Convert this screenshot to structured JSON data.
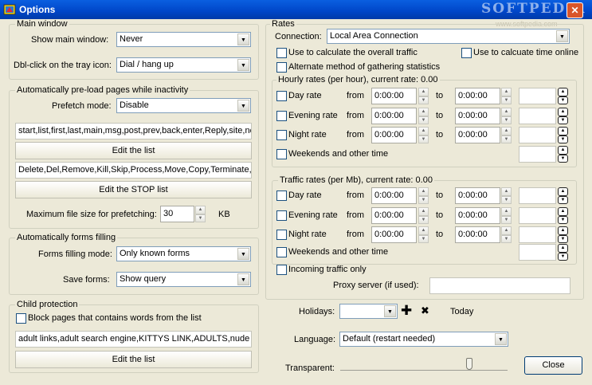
{
  "window": {
    "title": "Options",
    "watermark": "SOFTPEDIA",
    "watermark_url": "www.softpedia.com",
    "close_glyph": "✕"
  },
  "main_window": {
    "group_label": "Main window",
    "show_label": "Show main window:",
    "show_value": "Never",
    "dblclick_label": "Dbl-click on the tray icon:",
    "dblclick_value": "Dial / hang up"
  },
  "preload": {
    "group_label": "Automatically pre-load pages while inactivity",
    "prefetch_label": "Prefetch mode:",
    "prefetch_value": "Disable",
    "list_value": "start,list,first,last,main,msg,post,prev,back,enter,Reply,site,ne",
    "edit_list_button": "Edit the list",
    "stop_list_value": "Delete,Del,Remove,Kill,Skip,Process,Move,Copy,Terminate,St",
    "edit_stop_button": "Edit the STOP list",
    "maxsize_label": "Maximum file size for prefetching:",
    "maxsize_value": "30",
    "maxsize_unit": "KB"
  },
  "forms": {
    "group_label": "Automatically forms filling",
    "mode_label": "Forms filling mode:",
    "mode_value": "Only known forms",
    "save_label": "Save forms:",
    "save_value": "Show query"
  },
  "child": {
    "group_label": "Child protection",
    "block_label": "Block pages that contains words from the list",
    "list_value": "adult links,adult search engine,KITTYS LINK,ADULTS,nude jp",
    "edit_button": "Edit the list"
  },
  "rates": {
    "group_label": "Rates",
    "connection_label": "Connection:",
    "connection_value": "Local Area Connection",
    "overall_label": "Use to calculate the overall traffic",
    "time_online_label": "Use to calcuate time online",
    "alt_method_label": "Alternate method of gathering statistics",
    "hourly_label": "Hourly rates (per hour), current rate: 0.00",
    "traffic_label": "Traffic rates (per Mb), current rate: 0.00",
    "from_label": "from",
    "to_label": "to",
    "hourly_rows": [
      {
        "label": "Day rate",
        "from": "0:00:00",
        "to": "0:00:00"
      },
      {
        "label": "Evening rate",
        "from": "0:00:00",
        "to": "0:00:00"
      },
      {
        "label": "Night rate",
        "from": "0:00:00",
        "to": "0:00:00"
      }
    ],
    "hourly_weekends": "Weekends and other time",
    "traffic_rows": [
      {
        "label": "Day rate",
        "from": "0:00:00",
        "to": "0:00:00"
      },
      {
        "label": "Evening rate",
        "from": "0:00:00",
        "to": "0:00:00"
      },
      {
        "label": "Night rate",
        "from": "0:00:00",
        "to": "0:00:00"
      }
    ],
    "traffic_weekends": "Weekends and other time",
    "incoming_label": "Incoming traffic only",
    "proxy_label": "Proxy server (if used):",
    "proxy_value": ""
  },
  "holidays": {
    "label": "Holidays:",
    "value": "",
    "today_label": "Today",
    "add_glyph": "✚",
    "remove_glyph": "✖"
  },
  "language": {
    "label": "Language:",
    "value": "Default (restart needed)"
  },
  "transparent": {
    "label": "Transparent:",
    "level": 0.78
  },
  "close_button": "Close",
  "glyphs": {
    "up": "▲",
    "down": "▼"
  }
}
